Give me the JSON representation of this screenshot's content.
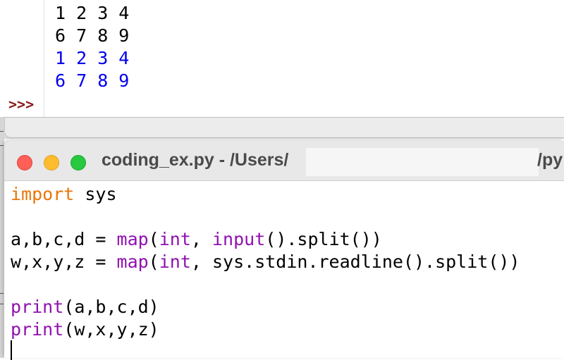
{
  "shell": {
    "output_lines": [
      {
        "text": "1 2 3 4",
        "kind": "input"
      },
      {
        "text": "6 7 8 9",
        "kind": "input"
      },
      {
        "text": "1 2 3 4",
        "kind": "output"
      },
      {
        "text": "6 7 8 9",
        "kind": "output"
      }
    ],
    "prompt": ">>>",
    "colors": {
      "stdin_text": "#000000",
      "stdout_text": "#0000ee",
      "prompt": "#8b1a1a"
    }
  },
  "editor": {
    "title": "coding_ex.py - /Users/",
    "title_suffix": "/py",
    "traffic_lights": [
      {
        "name": "close-button",
        "color": "#fe5f57"
      },
      {
        "name": "minimize-button",
        "color": "#febc2e"
      },
      {
        "name": "maximize-button",
        "color": "#28c840"
      }
    ],
    "code_lines": [
      [
        {
          "text": "import",
          "kind": "keyword"
        },
        {
          "text": " sys",
          "kind": "plain"
        }
      ],
      [],
      [
        {
          "text": "a,b,c,d = ",
          "kind": "plain"
        },
        {
          "text": "map",
          "kind": "builtin"
        },
        {
          "text": "(",
          "kind": "plain"
        },
        {
          "text": "int",
          "kind": "builtin"
        },
        {
          "text": ", ",
          "kind": "plain"
        },
        {
          "text": "input",
          "kind": "builtin"
        },
        {
          "text": "().split())",
          "kind": "plain"
        }
      ],
      [
        {
          "text": "w,x,y,z = ",
          "kind": "plain"
        },
        {
          "text": "map",
          "kind": "builtin"
        },
        {
          "text": "(",
          "kind": "plain"
        },
        {
          "text": "int",
          "kind": "builtin"
        },
        {
          "text": ", sys.stdin.readline().split())",
          "kind": "plain"
        }
      ],
      [],
      [
        {
          "text": "print",
          "kind": "builtin"
        },
        {
          "text": "(a,b,c,d)",
          "kind": "plain"
        }
      ],
      [
        {
          "text": "print",
          "kind": "builtin"
        },
        {
          "text": "(w,x,y,z)",
          "kind": "plain"
        }
      ]
    ],
    "colors": {
      "keyword": "#e8760b",
      "builtin": "#9010b0",
      "plain": "#000000"
    }
  }
}
